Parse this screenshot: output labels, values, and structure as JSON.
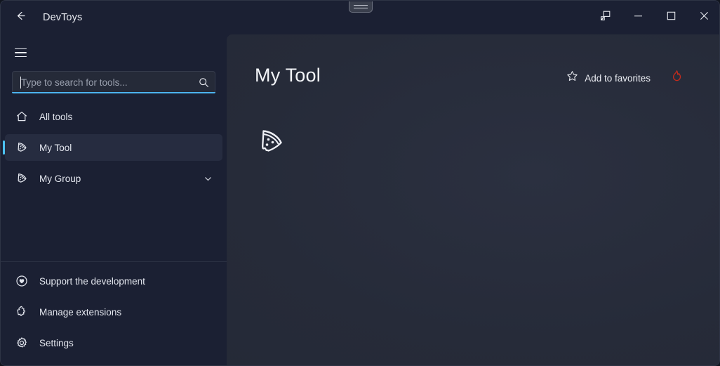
{
  "window": {
    "app_title": "DevToys",
    "back_icon": "back-arrow-icon",
    "drag_handle_icon": "window-drag-handle-icon"
  },
  "window_controls": [
    {
      "name": "compact-overlay-button",
      "icon": "compact-overlay-icon",
      "tooltip": "Compact overlay"
    },
    {
      "name": "minimize-button",
      "icon": "minimize-icon",
      "tooltip": "Minimize"
    },
    {
      "name": "maximize-button",
      "icon": "maximize-icon",
      "tooltip": "Maximize"
    },
    {
      "name": "close-button",
      "icon": "close-icon",
      "tooltip": "Close"
    }
  ],
  "sidebar": {
    "menu_icon": "hamburger-icon",
    "search": {
      "placeholder": "Type to search for tools...",
      "value": "",
      "icon": "search-icon",
      "focused": true
    },
    "items": [
      {
        "label": "All tools",
        "icon": "home-icon",
        "selected": false,
        "expandable": false
      },
      {
        "label": "My Tool",
        "icon": "pizza-slice-icon",
        "selected": true,
        "expandable": false
      },
      {
        "label": "My Group",
        "icon": "pizza-slice-icon",
        "selected": false,
        "expandable": true,
        "chevron": "chevron-down-icon"
      }
    ],
    "bottom_items": [
      {
        "label": "Support the development",
        "icon": "heart-circle-icon"
      },
      {
        "label": "Manage extensions",
        "icon": "puzzle-piece-icon"
      },
      {
        "label": "Settings",
        "icon": "gear-icon"
      }
    ]
  },
  "main": {
    "title": "My Tool",
    "favorite_label": "Add to favorites",
    "favorite_icon": "star-outline-icon",
    "flame_icon": "flame-icon",
    "tool_icon": "pizza-slice-icon"
  },
  "colors": {
    "sidebar_bg": "#1b2033",
    "content_bg": "#262b39",
    "accent": "#4cc2f1",
    "selected_row": "#262c40",
    "flame_red": "#c42b1c",
    "text_primary": "#e9ebf1",
    "text_placeholder": "#9aa0ae"
  }
}
